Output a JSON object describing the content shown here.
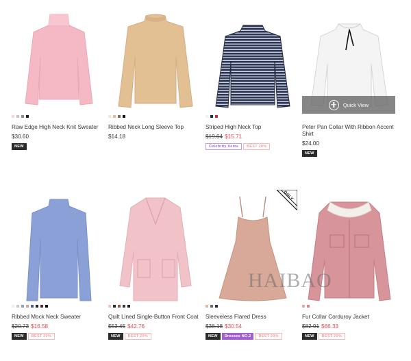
{
  "products": [
    {
      "name": "Raw Edge High Neck Knit Sweater",
      "price": "$30.60",
      "old_price": null,
      "sale_price": null,
      "swatches": [
        "#f5d5dc",
        "#c9c1b7",
        "#8a8f99",
        "#222222"
      ],
      "badges": [
        {
          "type": "new",
          "label": "NEW"
        }
      ]
    },
    {
      "name": "Ribbed Neck Long Sleeve Top",
      "price": "$14.18",
      "old_price": null,
      "sale_price": null,
      "swatches": [
        "#f2e6d9",
        "#e7b9a4",
        "#7a6d66",
        "#151515"
      ],
      "badges": []
    },
    {
      "name": "Striped High Neck Top",
      "price": null,
      "old_price": "$19.64",
      "sale_price": "$15.71",
      "swatches": [
        "#f2f2f2",
        "#222a4a",
        "#c0304a"
      ],
      "badges": [
        {
          "type": "celeb",
          "label": "Celebrity Items"
        },
        {
          "type": "best",
          "label": "BEST 20%"
        }
      ]
    },
    {
      "name": "Peter Pan Collar With Ribbon Accent Shirt",
      "price": "$24.00",
      "old_price": null,
      "sale_price": null,
      "swatches": [],
      "badges": [
        {
          "type": "new",
          "label": "NEW"
        }
      ],
      "quick_view": "Quick View"
    },
    {
      "name": "Ribbed Mock Neck Sweater",
      "price": null,
      "old_price": "$20.73",
      "sale_price": "$16.58",
      "swatches": [
        "#eeeeee",
        "#c9c9c9",
        "#8f9fc9",
        "#c8a2a8",
        "#4a5f9c",
        "#252525",
        "#5a2a3b",
        "#111111"
      ],
      "badges": [
        {
          "type": "new",
          "label": "NEW"
        },
        {
          "type": "best",
          "label": "BEST 20%"
        }
      ]
    },
    {
      "name": "Quilt Lined Single-Button Front Coat",
      "price": null,
      "old_price": "$53.45",
      "sale_price": "$42.76",
      "swatches": [
        "#f4c6cc",
        "#2b2b2b",
        "#8a5a50",
        "#3a3a3a",
        "#1c1c1c"
      ],
      "badges": [
        {
          "type": "new",
          "label": "NEW"
        },
        {
          "type": "best",
          "label": "BEST 20%"
        }
      ]
    },
    {
      "name": "Sleeveless Flared Dress",
      "price": null,
      "old_price": "$38.18",
      "sale_price": "$30.54",
      "swatches": [
        "#e3b8a8",
        "#6c6c6c",
        "#2a3144"
      ],
      "badges": [
        {
          "type": "new",
          "label": "NEW"
        },
        {
          "type": "dress",
          "label": "Dresses NO.2"
        },
        {
          "type": "best",
          "label": "BEST 20%"
        }
      ]
    },
    {
      "name": "Fur Collar Corduroy Jacket",
      "price": null,
      "old_price": "$82.91",
      "sale_price": "$66.33",
      "swatches": [
        "#e8a7a0",
        "#d88b88"
      ],
      "badges": [
        {
          "type": "new",
          "label": "NEW"
        },
        {
          "type": "best",
          "label": "BEST 20%"
        }
      ]
    }
  ],
  "only_tag": "ONLY",
  "watermark": "HAIBAO"
}
